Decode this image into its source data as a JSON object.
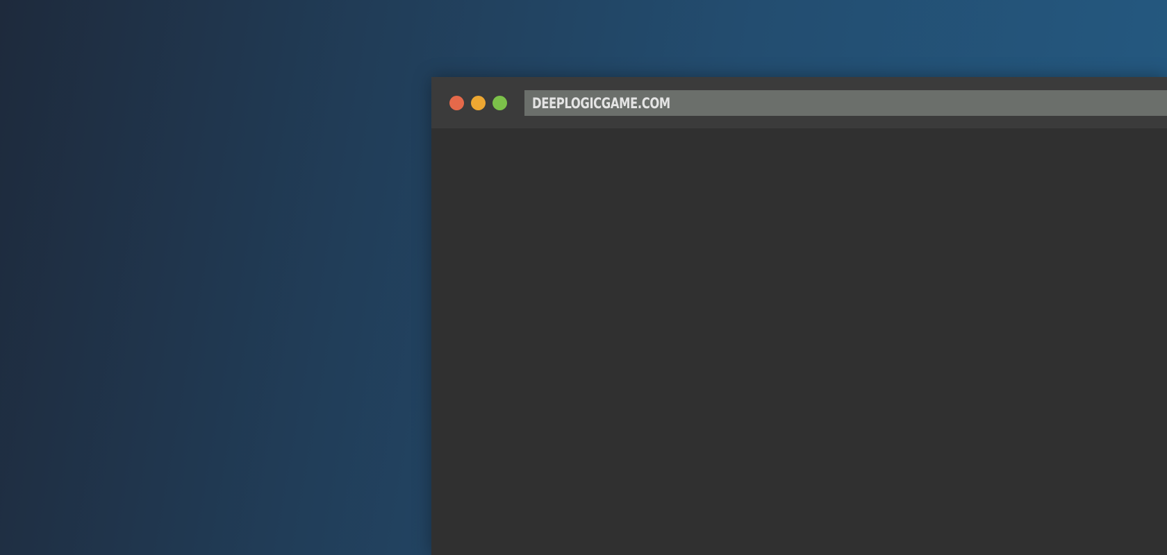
{
  "browser": {
    "address": "DEEPLOGICGAME.COM",
    "controls": {
      "close_color": "#e5694a",
      "minimize_color": "#eda732",
      "maximize_color": "#7cc14a"
    }
  }
}
